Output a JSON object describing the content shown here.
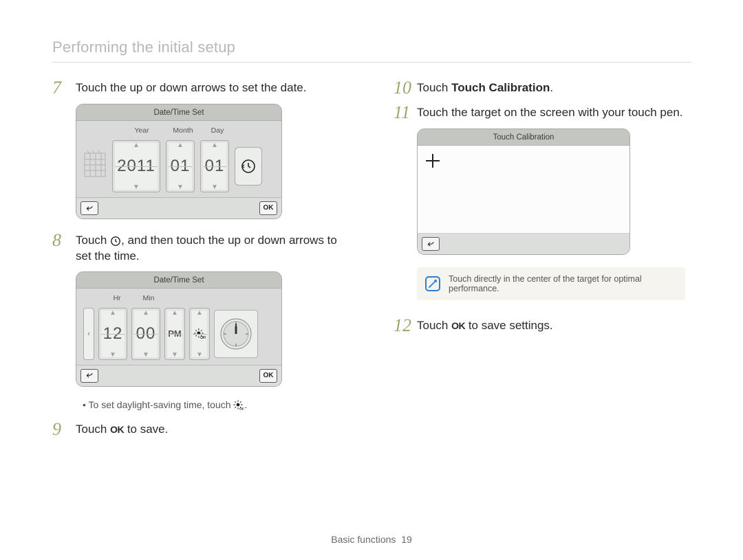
{
  "header": {
    "title": "Performing the initial setup"
  },
  "footer": {
    "section": "Basic functions",
    "page": "19"
  },
  "steps": {
    "s7": {
      "num": "7",
      "text": "Touch the up or down arrows to set the date."
    },
    "s8": {
      "num": "8",
      "prefix": "Touch ",
      "suffix": ", and then touch the up or down arrows to set the time."
    },
    "s8bullet": "To set daylight-saving time, touch ",
    "s9": {
      "num": "9",
      "prefix": "Touch ",
      "suffix": " to save.",
      "ok": "OK"
    },
    "s10": {
      "num": "10",
      "prefix": "Touch ",
      "bold": "Touch Calibration",
      "suffix": "."
    },
    "s11": {
      "num": "11",
      "text": "Touch the target on the screen with your touch pen."
    },
    "s12": {
      "num": "12",
      "prefix": "Touch ",
      "suffix": " to save settings.",
      "ok": "OK"
    }
  },
  "note": {
    "text": "Touch directly in the center of the target for optimal performance."
  },
  "screens": {
    "date": {
      "title": "Date/Time Set",
      "labels": {
        "year": "Year",
        "month": "Month",
        "day": "Day"
      },
      "values": {
        "year": "2011",
        "month": "01",
        "day": "01"
      },
      "ok": "OK"
    },
    "time": {
      "title": "Date/Time Set",
      "labels": {
        "hr": "Hr",
        "min": "Min"
      },
      "values": {
        "hr": "12",
        "min": "00",
        "ampm": "PM"
      },
      "ok": "OK"
    },
    "calibration": {
      "title": "Touch Calibration"
    }
  }
}
